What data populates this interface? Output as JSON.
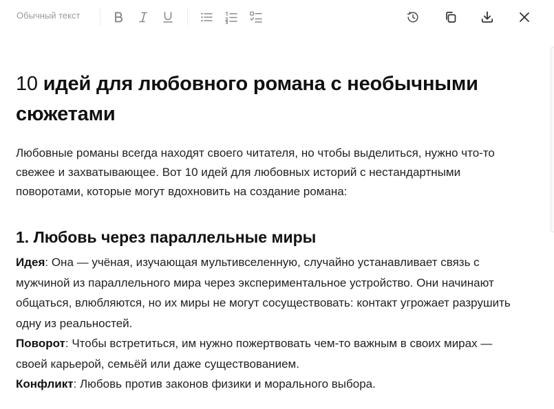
{
  "toolbar": {
    "text_style": "Обычный текст",
    "icons": [
      "bold-icon",
      "italic-icon",
      "underline-icon",
      "bullet-list-icon",
      "numbered-list-icon",
      "checklist-icon",
      "history-icon",
      "copy-icon",
      "download-icon",
      "close-icon"
    ]
  },
  "document": {
    "title_number": "10",
    "title_text": " идей для любовного романа с необычными сюжетами",
    "intro": "Любовные романы всегда находят своего читателя, но чтобы выделиться, нужно что-то свежее и захватывающее. Вот 10 идей для любовных историй с нестандартными поворотами, которые могут вдохновить на создание романа:",
    "sections": [
      {
        "title": "1. Любовь через параллельные миры",
        "idea_label": "Идея",
        "idea_text": ": Она — учёная, изучающая мультивселенную, случайно устанавливает связь с мужчиной из параллельного мира через экспериментальное устройство. Они начинают общаться, влюбляются, но их миры не могут сосуществовать: контакт угрожает разрушить одну из реальностей.",
        "twist_label": "Поворот",
        "twist_text": ": Чтобы встретиться, им нужно пожертвовать чем-то важным в своих мирах — своей карьерой, семьёй или даже существованием.",
        "conflict_label": "Конфликт",
        "conflict_text": ": Любовь против законов физики и морального выбора."
      }
    ]
  },
  "colors": {
    "text": "#222222",
    "heading": "#111111",
    "muted": "#9a9a9a",
    "icon": "#555555"
  }
}
